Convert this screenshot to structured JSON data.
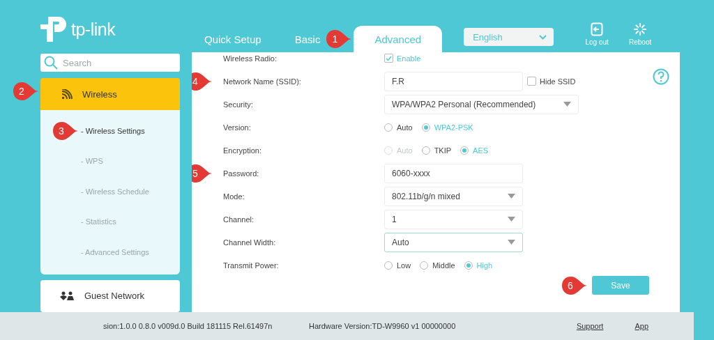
{
  "header": {
    "logo": "tp-link",
    "tabs": [
      {
        "label": "Quick Setup",
        "selected": false
      },
      {
        "label": "Basic",
        "selected": false
      },
      {
        "label": "Advanced",
        "selected": true,
        "callout": "1"
      }
    ],
    "language": "English",
    "actions": [
      {
        "kind": "logout",
        "label": "Log out"
      },
      {
        "kind": "reboot",
        "label": "Reboot"
      }
    ]
  },
  "sidebar": {
    "search": {
      "placeholder": "Search"
    },
    "items": [
      {
        "kind": "wireless",
        "label": "Wireless",
        "selected": true,
        "expanded": true,
        "callout": "2",
        "children": [
          {
            "label": "- Wireless Settings",
            "selected": true,
            "callout": "3"
          },
          {
            "label": "- WPS",
            "selected": false
          },
          {
            "label": "- Wireless Schedule",
            "selected": false
          },
          {
            "label": "- Statistics",
            "selected": false
          },
          {
            "label": "- Advanced Settings",
            "selected": false
          }
        ]
      },
      {
        "kind": "guest",
        "label": "Guest Network",
        "selected": false,
        "expanded": false
      }
    ]
  },
  "form": {
    "rows": [
      {
        "kind": "checkbox",
        "label": "Wireless Radio:",
        "option": {
          "label": "Enable",
          "checked": true
        }
      },
      {
        "kind": "input",
        "label": "Network Name (SSID):",
        "value": "F.R",
        "callout": "4",
        "extra": {
          "label": "Hide SSID",
          "checked": false
        }
      },
      {
        "kind": "select",
        "label": "Security:",
        "value": "WPA/WPA2 Personal (Recommended)",
        "focused": false
      },
      {
        "kind": "radio",
        "label": "Version:",
        "options": [
          {
            "label": "Auto",
            "selected": false,
            "disabled": false
          },
          {
            "label": "WPA2-PSK",
            "selected": true,
            "disabled": false
          }
        ]
      },
      {
        "kind": "radio",
        "label": "Encryption:",
        "options": [
          {
            "label": "Auto",
            "selected": false,
            "disabled": true
          },
          {
            "label": "TKIP",
            "selected": false,
            "disabled": false
          },
          {
            "label": "AES",
            "selected": true,
            "disabled": false
          }
        ]
      },
      {
        "kind": "input",
        "label": "Password:",
        "value": "6060-xxxx",
        "callout": "5"
      },
      {
        "kind": "select",
        "label": "Mode:",
        "value": "802.11b/g/n mixed",
        "focused": false
      },
      {
        "kind": "select",
        "label": "Channel:",
        "value": "1",
        "focused": false
      },
      {
        "kind": "select",
        "label": "Channel Width:",
        "value": "Auto",
        "focused": true
      },
      {
        "kind": "radio",
        "label": "Transmit Power:",
        "options": [
          {
            "label": "Low",
            "selected": false,
            "disabled": false
          },
          {
            "label": "Middle",
            "selected": false,
            "disabled": false
          },
          {
            "label": "High",
            "selected": true,
            "disabled": false
          }
        ]
      }
    ],
    "save": {
      "label": "Save",
      "callout": "6"
    }
  },
  "footer": {
    "firmware": "sion:1.0.0 0.8.0 v009d.0 Build 181115 Rel.61497n",
    "hardware": "Hardware Version:TD-W9960 v1 00000000",
    "links": [
      "Support",
      "App"
    ]
  }
}
